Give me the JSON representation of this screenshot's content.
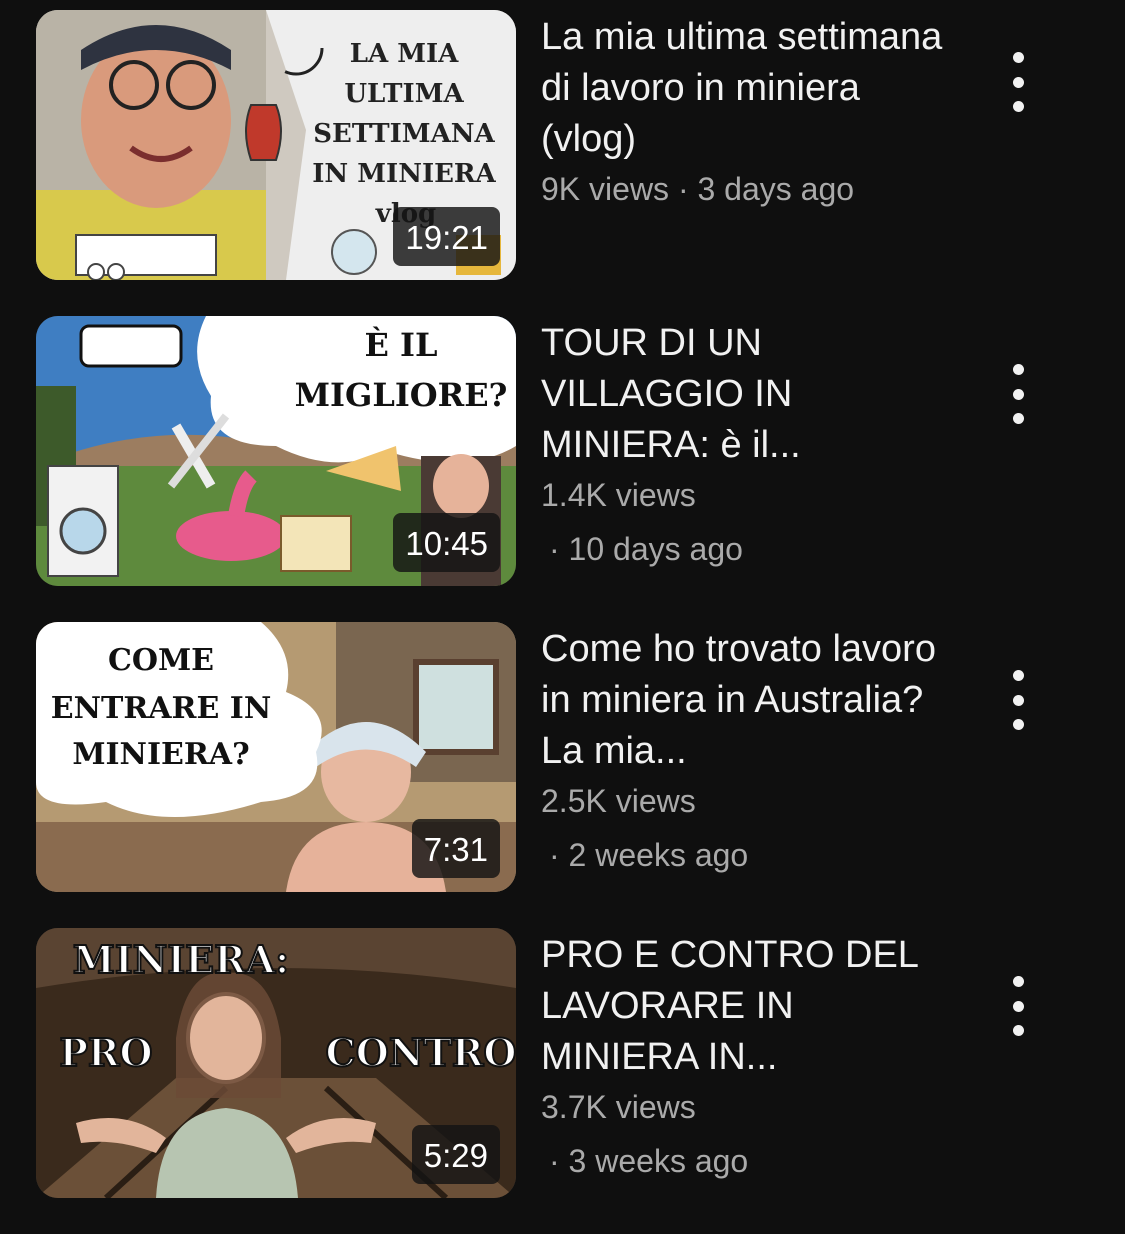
{
  "videos": [
    {
      "title": "La mia ultima settimana di lavoro in miniera (vlog)",
      "info": "9K views · 3 days ago",
      "views": "",
      "age": "",
      "duration": "19:21",
      "thumb_text": [
        "LA MIA",
        "ULTIMA",
        "SETTIMANA",
        "IN MINIERA",
        "vlog"
      ]
    },
    {
      "title": "TOUR DI UN VILLAGGIO IN MINIERA: è il...",
      "info": "",
      "views": "1.4K views",
      "age": "· 10 days ago",
      "duration": "10:45",
      "thumb_text": [
        "È IL",
        "MIGLIORE?"
      ]
    },
    {
      "title": "Come ho trovato lavoro in miniera in Australia? La mia...",
      "info": "",
      "views": "2.5K views",
      "age": "· 2 weeks ago",
      "duration": "7:31",
      "thumb_text": [
        "COME",
        "ENTRARE IN",
        "MINIERA?"
      ]
    },
    {
      "title": "PRO E CONTRO DEL LAVORARE IN MINIERA IN...",
      "info": "",
      "views": "3.7K views",
      "age": "· 3 weeks ago",
      "duration": "5:29",
      "thumb_text": [
        "MINIERA:",
        "PRO",
        "CONTRO"
      ]
    }
  ],
  "icons": {
    "menu": "more-vert-icon"
  },
  "colors": {
    "background": "#0f0f0f",
    "title_text": "#f1f1f1",
    "meta_text": "#aaaaaa"
  }
}
